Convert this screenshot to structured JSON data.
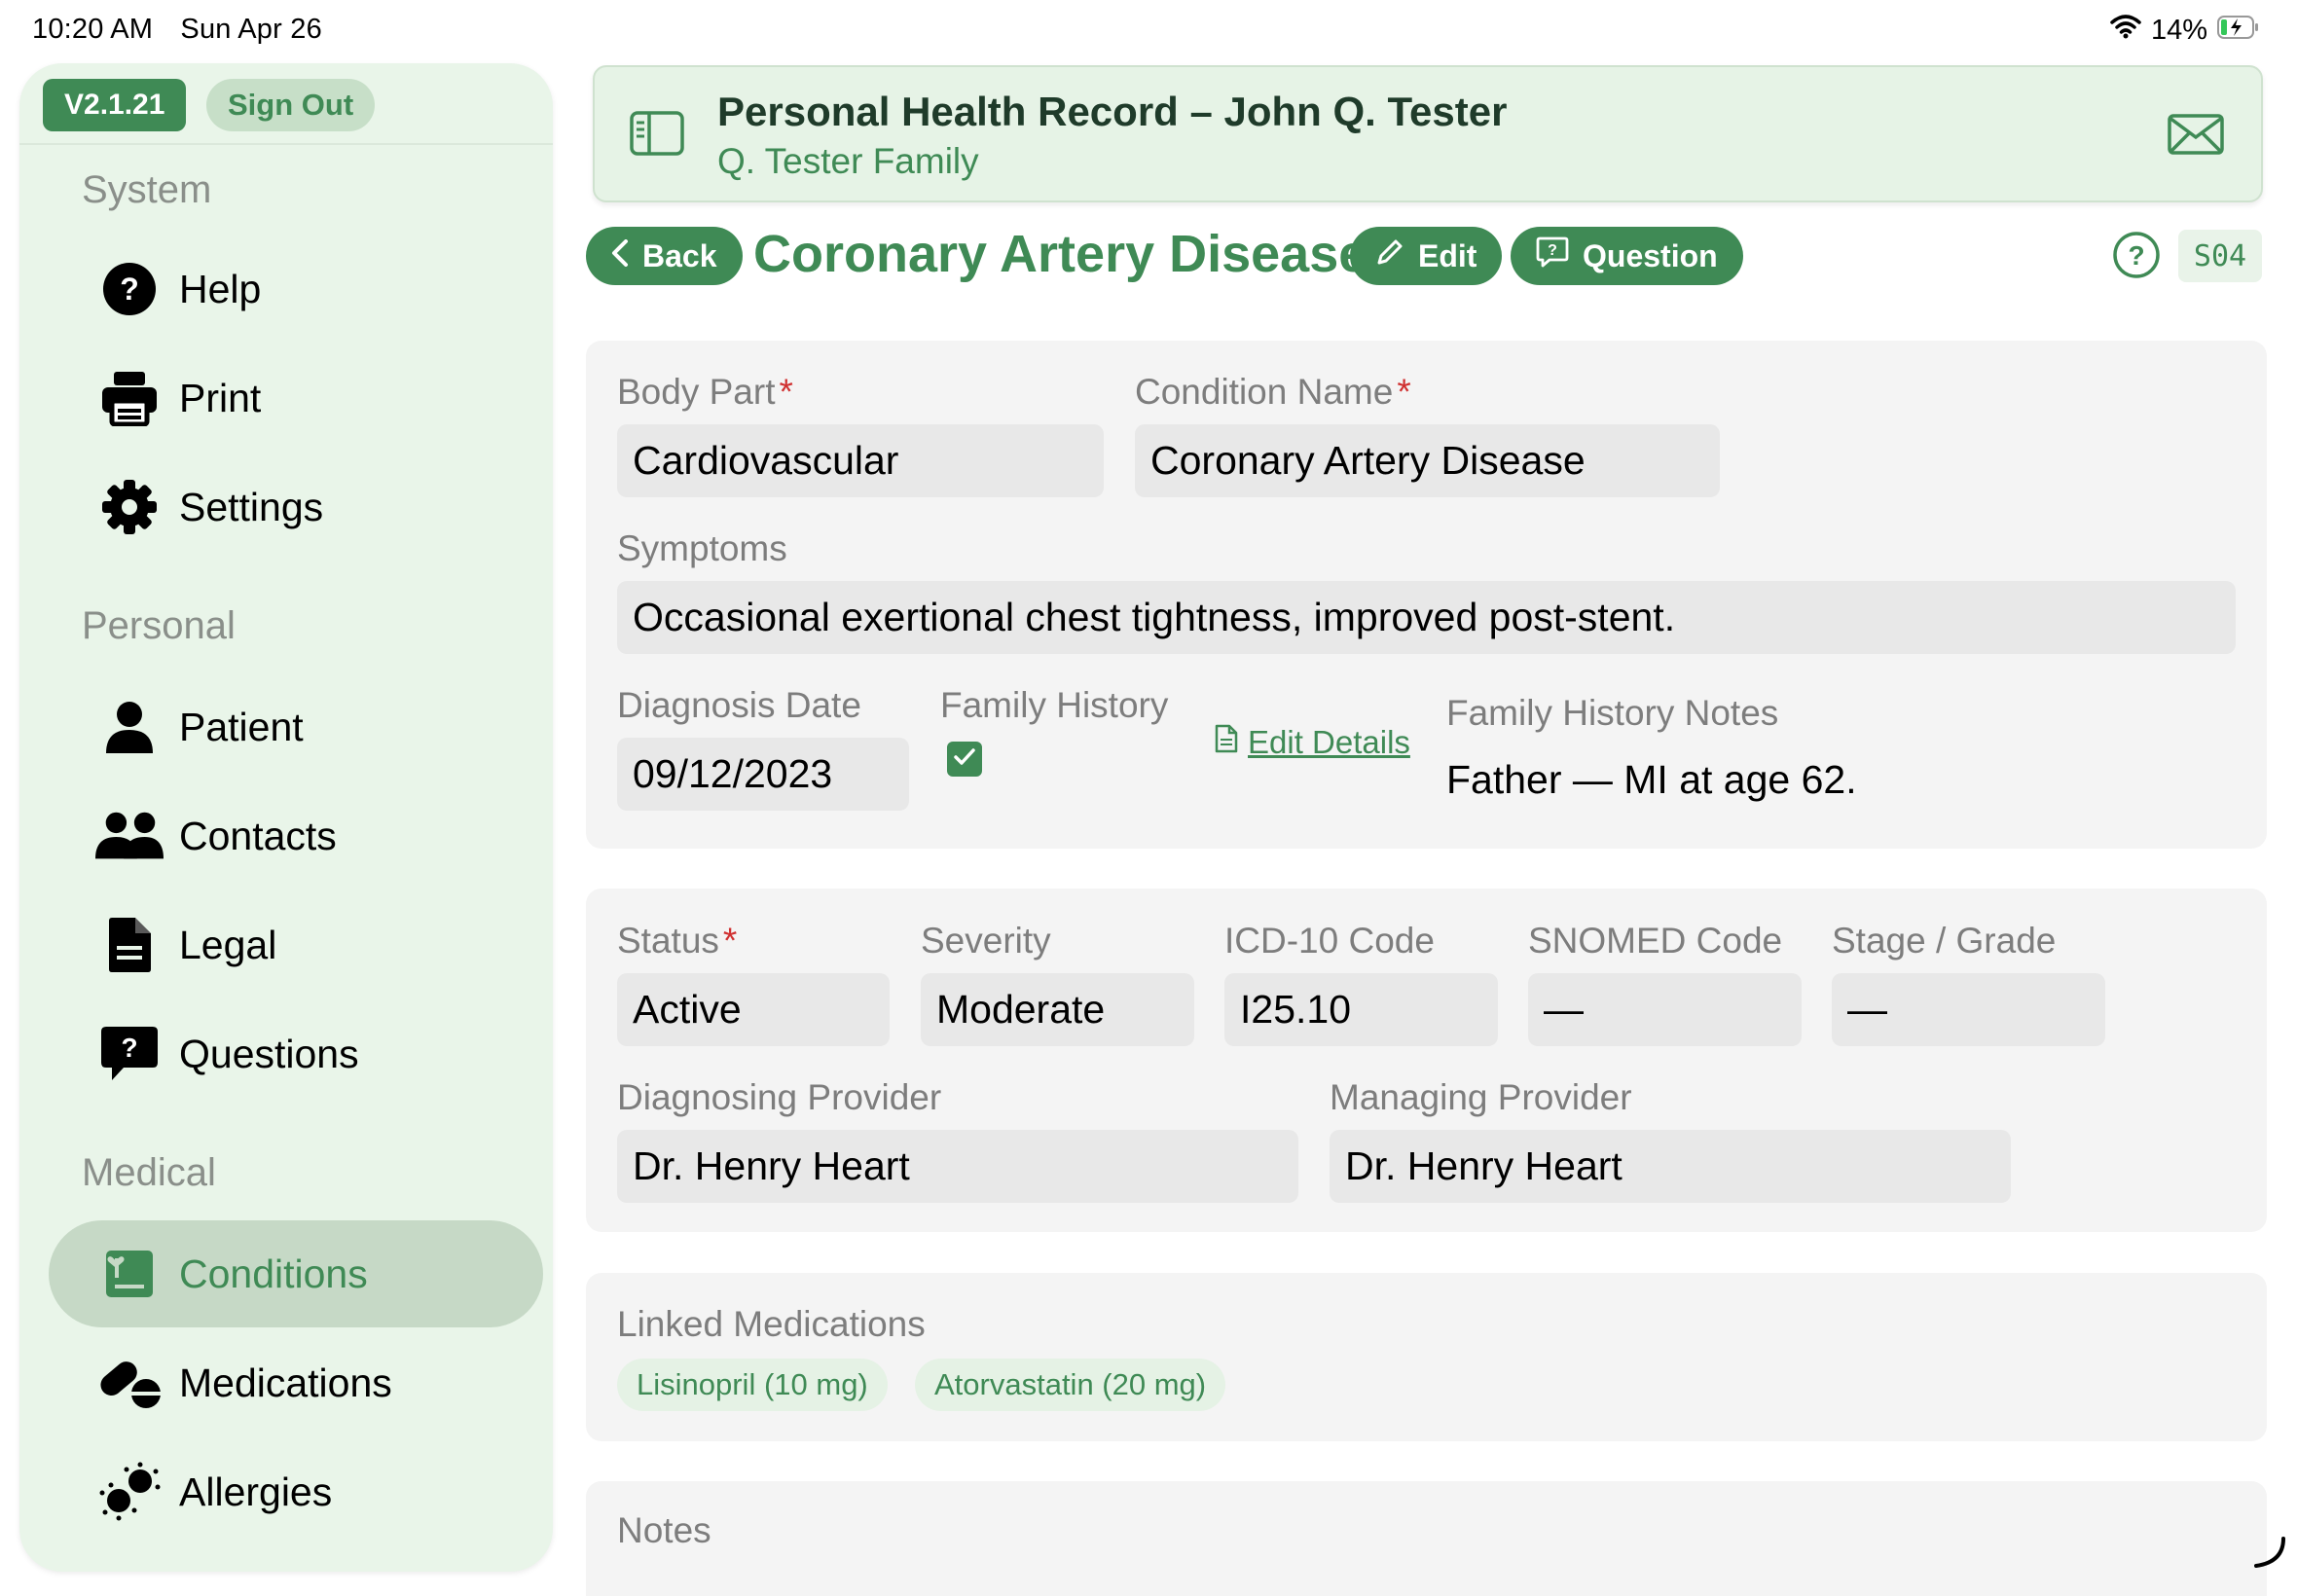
{
  "status_bar": {
    "time": "10:20 AM",
    "date": "Sun Apr 26",
    "battery": "14%"
  },
  "sidebar": {
    "version": "V2.1.21",
    "sign_out": "Sign Out",
    "sections": [
      {
        "header": "System",
        "items": [
          {
            "label": "Help"
          },
          {
            "label": "Print"
          },
          {
            "label": "Settings"
          }
        ]
      },
      {
        "header": "Personal",
        "items": [
          {
            "label": "Patient"
          },
          {
            "label": "Contacts"
          },
          {
            "label": "Legal"
          },
          {
            "label": "Questions"
          }
        ]
      },
      {
        "header": "Medical",
        "items": [
          {
            "label": "Conditions",
            "active": true
          },
          {
            "label": "Medications"
          },
          {
            "label": "Allergies"
          }
        ]
      }
    ]
  },
  "header": {
    "title": "Personal Health Record – John Q. Tester",
    "subtitle": "Q. Tester Family"
  },
  "toolbar": {
    "back": "Back",
    "page_title": "Coronary Artery Disease",
    "edit": "Edit",
    "question": "Question",
    "screen_code": "S04"
  },
  "condition": {
    "body_part": {
      "label": "Body Part",
      "value": "Cardiovascular"
    },
    "condition_name": {
      "label": "Condition Name",
      "value": "Coronary Artery Disease"
    },
    "symptoms": {
      "label": "Symptoms",
      "value": "Occasional exertional chest tightness, improved post-stent."
    },
    "diagnosis_date": {
      "label": "Diagnosis Date",
      "value": "09/12/2023"
    },
    "family_history": {
      "label": "Family History",
      "checked": true,
      "edit_details": "Edit Details"
    },
    "family_history_notes": {
      "label": "Family History Notes",
      "value": "Father — MI at age 62."
    },
    "status": {
      "label": "Status",
      "value": "Active"
    },
    "severity": {
      "label": "Severity",
      "value": "Moderate"
    },
    "icd10": {
      "label": "ICD-10 Code",
      "value": "I25.10"
    },
    "snomed": {
      "label": "SNOMED Code",
      "value": "—"
    },
    "stage": {
      "label": "Stage / Grade",
      "value": "—"
    },
    "diagnosing_provider": {
      "label": "Diagnosing Provider",
      "value": "Dr. Henry Heart"
    },
    "managing_provider": {
      "label": "Managing Provider",
      "value": "Dr. Henry Heart"
    },
    "linked_medications": {
      "label": "Linked Medications",
      "items": [
        "Lisinopril (10 mg)",
        "Atorvastatin (20 mg)"
      ]
    },
    "notes": {
      "label": "Notes"
    }
  },
  "colors": {
    "accent": "#3f8a55",
    "sidebar_bg": "#e9f5e9",
    "required": "#d03030"
  }
}
